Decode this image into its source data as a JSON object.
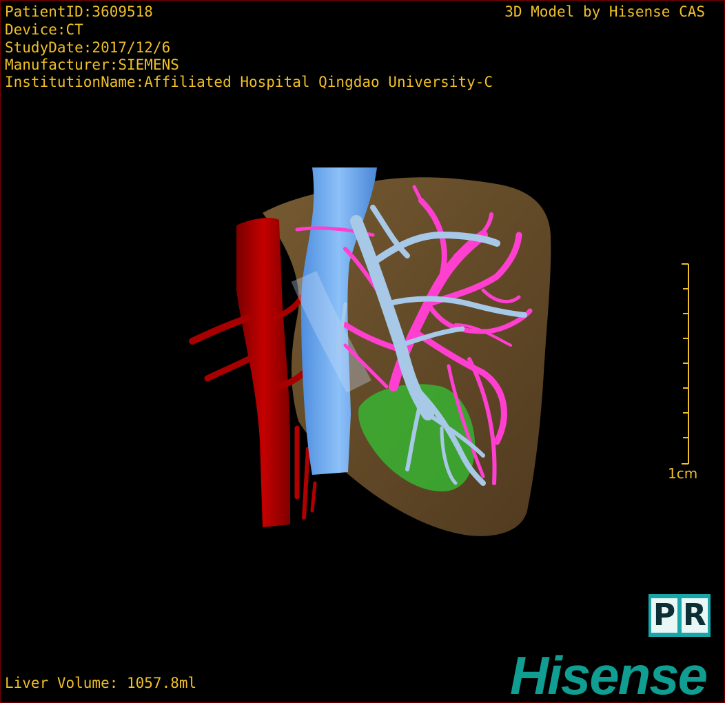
{
  "info": {
    "patient_id": "PatientID:3609518",
    "device": "Device:CT",
    "study_date": "StudyDate:2017/12/6",
    "manufacturer": "Manufacturer:SIEMENS",
    "institution": "InstitutionName:Affiliated Hospital Qingdao University-C"
  },
  "watermark": "3D Model by Hisense CAS",
  "scale": {
    "label": "1cm"
  },
  "liver_volume": "Liver Volume: 1057.8ml",
  "pr_button": {
    "letter1": "P",
    "letter2": "R"
  },
  "brand": "Hisense",
  "colors": {
    "overlay_text": "#f0c028",
    "liver": "#7a5a2e",
    "artery": "#b00000",
    "vena_cava": "#6aaaf0",
    "portal_vein": "#ff3fd0",
    "hepatic_vein": "#a8c8e8",
    "lesion": "#3cc83c",
    "brand": "#0f9e91"
  }
}
